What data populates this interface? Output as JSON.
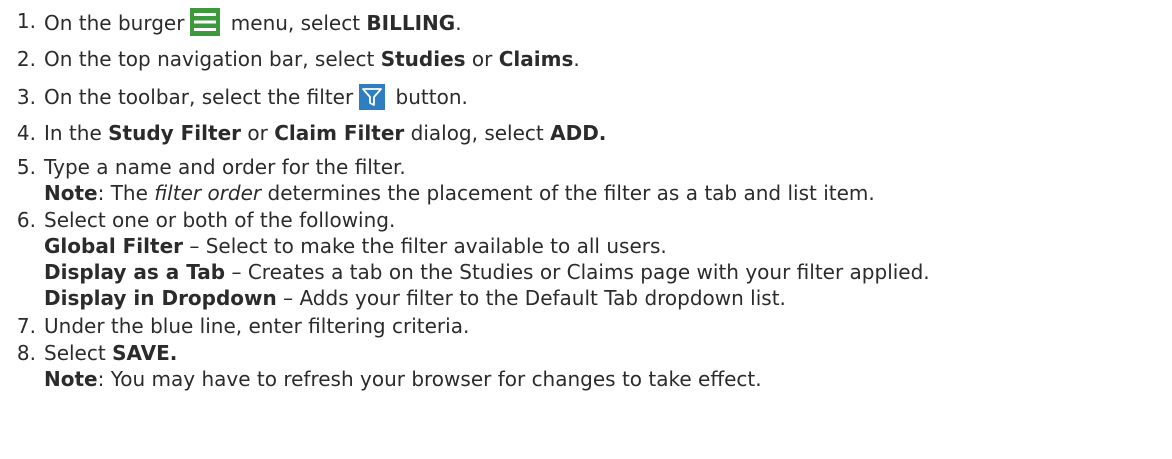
{
  "steps": [
    {
      "num": "1.",
      "pre": "On the burger",
      "icon": "burger-menu-icon",
      "mid": " menu, select ",
      "bold": "BILLING",
      "post": "."
    },
    {
      "num": "2.",
      "pre": "On the top navigation bar, select ",
      "b1": "Studies",
      "mid": " or ",
      "b2": "Claims",
      "post": "."
    },
    {
      "num": "3.",
      "pre": "On the toolbar, select the filter",
      "icon": "filter-icon",
      "post": " button."
    },
    {
      "num": "4.",
      "pre": "In the ",
      "b1": "Study Filter",
      "mid": " or ",
      "b2": "Claim Filter",
      "mid2": " dialog, select ",
      "b3": "ADD."
    },
    {
      "num": "5.",
      "text": "Type a name and order for the filter.",
      "note_label": "Note",
      "note_pre": ": The ",
      "note_em": "filter order",
      "note_post": " determines the placement of the filter as a tab and list item."
    },
    {
      "num": "6.",
      "text": "Select one or both of the following.",
      "opt1_label": "Global Filter",
      "opt1_text": " – Select to make the filter available to all users.",
      "opt2_label": "Display as a Tab",
      "opt2_text": " – Creates a tab on the Studies or Claims page with your filter applied.",
      "opt3_label": "Display in Dropdown",
      "opt3_text": " – Adds your filter to the Default Tab dropdown list."
    },
    {
      "num": "7.",
      "text": "Under the blue line, enter filtering criteria."
    },
    {
      "num": "8.",
      "pre": "Select ",
      "bold": "SAVE.",
      "note_label": "Note",
      "note_text": ": You may have to refresh your browser for changes to take effect."
    }
  ],
  "colors": {
    "text": "#2b2b2b",
    "burger_green": "#3c9a3c",
    "filter_blue": "#2f7fc0"
  }
}
